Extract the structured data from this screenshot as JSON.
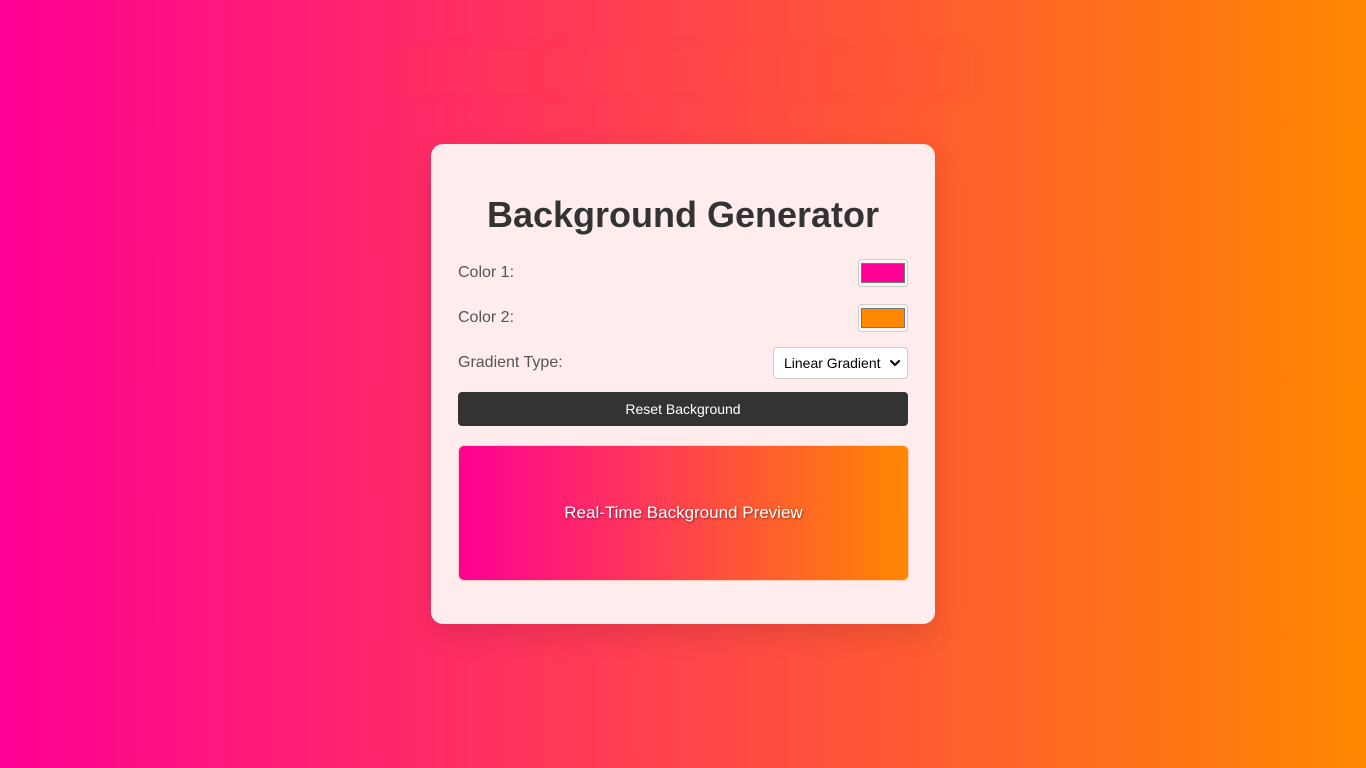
{
  "page": {
    "background_color_1": "#ff0095",
    "background_color_2": "#ff8800"
  },
  "card": {
    "title": "Background Generator",
    "color1": {
      "label": "Color 1:",
      "value": "#ff0095"
    },
    "color2": {
      "label": "Color 2:",
      "value": "#ff8800"
    },
    "gradient_type": {
      "label": "Gradient Type:",
      "selected": "Linear Gradient"
    },
    "reset_button_label": "Reset Background",
    "preview_text": "Real-Time Background Preview"
  },
  "icons": {
    "select_arrow": "chevron-down-icon"
  }
}
